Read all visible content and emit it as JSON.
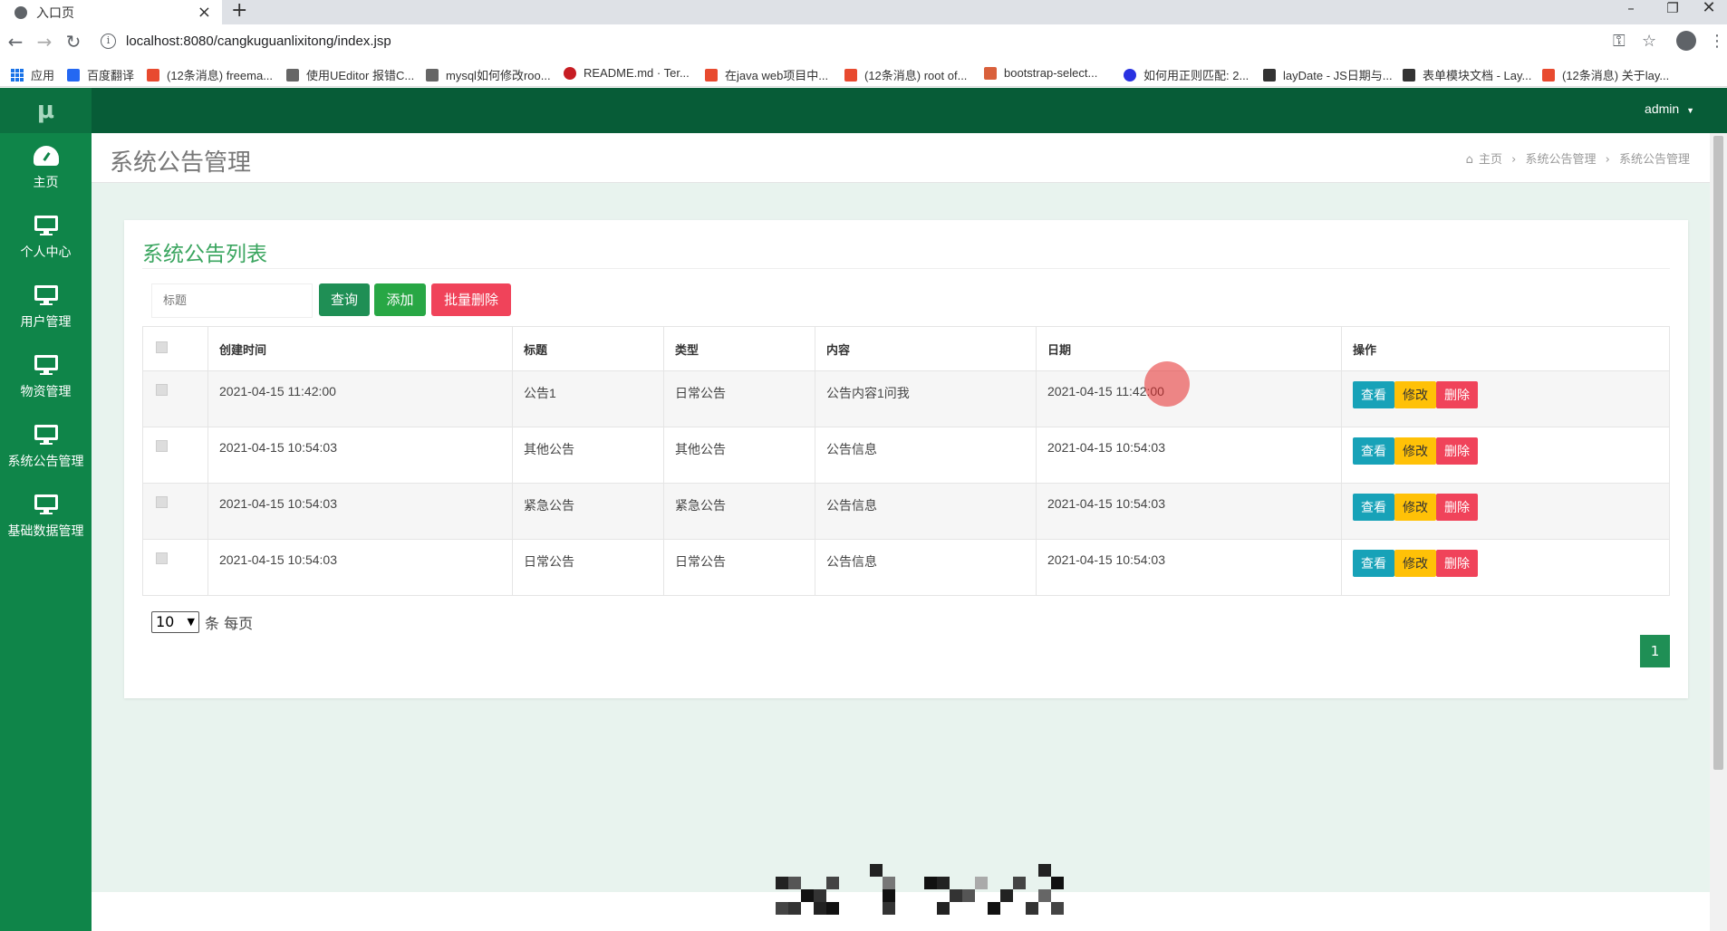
{
  "browser": {
    "tab_title": "入口页",
    "url": "localhost:8080/cangkuguanlixitong/index.jsp",
    "bookmarks": [
      {
        "label": "应用",
        "color": "#1a73e8"
      },
      {
        "label": "百度翻译",
        "color": "#2468f2"
      },
      {
        "label": "(12条消息) freema...",
        "color": "#e84a2f"
      },
      {
        "label": "使用UEditor 报错C...",
        "color": "#555555"
      },
      {
        "label": "mysql如何修改roo...",
        "color": "#555555"
      },
      {
        "label": "README.md · Ter...",
        "color": "#c71d23"
      },
      {
        "label": "在java web项目中...",
        "color": "#e84a2f"
      },
      {
        "label": "(12条消息) root of...",
        "color": "#e84a2f"
      },
      {
        "label": "bootstrap-select...",
        "color": "#d9603b"
      },
      {
        "label": "如何用正则匹配: 2...",
        "color": "#2932e1"
      },
      {
        "label": "layDate - JS日期与...",
        "color": "#333333"
      },
      {
        "label": "表单模块文档 - Lay...",
        "color": "#333333"
      },
      {
        "label": "(12条消息) 关于lay...",
        "color": "#e84a2f"
      }
    ]
  },
  "app": {
    "logo": "μ",
    "user": "admin",
    "sidebar": [
      {
        "label": "主页",
        "icon": "dashboard-icon"
      },
      {
        "label": "个人中心",
        "icon": "monitor-icon"
      },
      {
        "label": "用户管理",
        "icon": "monitor-icon"
      },
      {
        "label": "物资管理",
        "icon": "monitor-icon"
      },
      {
        "label": "系统公告管理",
        "icon": "monitor-icon"
      },
      {
        "label": "基础数据管理",
        "icon": "monitor-icon"
      }
    ],
    "page_title": "系统公告管理",
    "breadcrumb": [
      "主页",
      "系统公告管理",
      "系统公告管理"
    ],
    "card_title": "系统公告列表",
    "search": {
      "placeholder": "标题"
    },
    "buttons": {
      "query": "查询",
      "add": "添加",
      "batch_delete": "批量删除"
    },
    "table": {
      "headers": [
        "创建时间",
        "标题",
        "类型",
        "内容",
        "日期",
        "操作"
      ],
      "rows": [
        {
          "created": "2021-04-15 11:42:00",
          "title": "公告1",
          "type": "日常公告",
          "content": "公告内容1问我",
          "date": "2021-04-15 11:42:00"
        },
        {
          "created": "2021-04-15 10:54:03",
          "title": "其他公告",
          "type": "其他公告",
          "content": "公告信息",
          "date": "2021-04-15 10:54:03"
        },
        {
          "created": "2021-04-15 10:54:03",
          "title": "紧急公告",
          "type": "紧急公告",
          "content": "公告信息",
          "date": "2021-04-15 10:54:03"
        },
        {
          "created": "2021-04-15 10:54:03",
          "title": "日常公告",
          "type": "日常公告",
          "content": "公告信息",
          "date": "2021-04-15 10:54:03"
        }
      ],
      "actions": {
        "view": "查看",
        "edit": "修改",
        "delete": "删除"
      }
    },
    "pagination": {
      "page_size": "10",
      "per_page_label": "条 每页",
      "current_page": "1"
    },
    "colors": {
      "sidebar": "#0f8549",
      "topbar": "#075c37",
      "view_btn": "#17a2b8",
      "edit_btn": "#ffc107",
      "delete_btn": "#f0435a",
      "query_btn": "#1f8f55",
      "add_btn": "#28a745",
      "batch_delete_btn": "#f0435a"
    }
  }
}
